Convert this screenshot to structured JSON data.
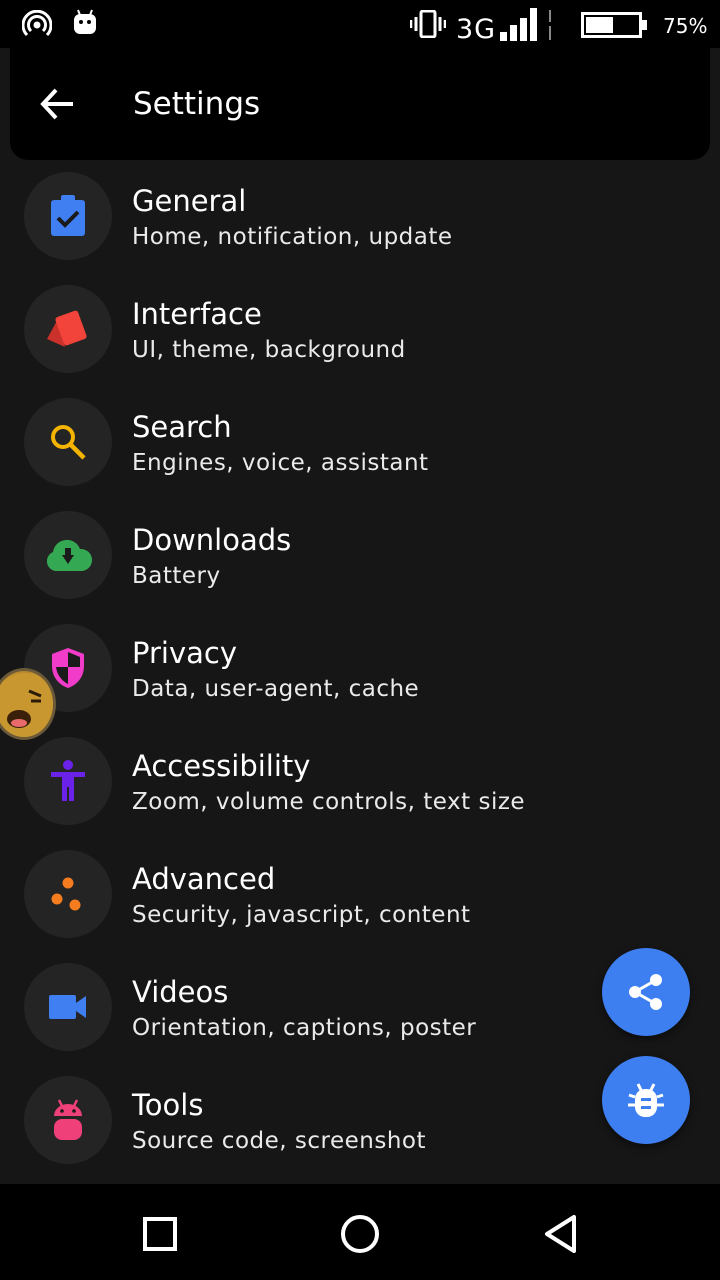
{
  "status_bar": {
    "network": "3G",
    "battery_percent": "75%",
    "battery_level": 0.75,
    "icons": [
      "hotspot-icon",
      "android-icon",
      "vibrate-icon",
      "signal-icon",
      "battery-icon"
    ]
  },
  "app_bar": {
    "title": "Settings",
    "back_icon": "arrow-back-icon"
  },
  "settings": [
    {
      "title": "General",
      "subtitle": "Home, notification, update",
      "icon": "clipboard-check-icon",
      "color": "#3f7ff2"
    },
    {
      "title": "Interface",
      "subtitle": "UI, theme, background",
      "icon": "cards-icon",
      "color": "#f2443a"
    },
    {
      "title": "Search",
      "subtitle": "Engines, voice, assistant",
      "icon": "search-icon",
      "color": "#f4b400"
    },
    {
      "title": "Downloads",
      "subtitle": "Battery",
      "icon": "cloud-download-icon",
      "color": "#34a853"
    },
    {
      "title": "Privacy",
      "subtitle": "Data, user-agent, cache",
      "icon": "shield-icon",
      "color": "#f03cc8"
    },
    {
      "title": "Accessibility",
      "subtitle": "Zoom, volume controls, text size",
      "icon": "accessibility-icon",
      "color": "#6a22e8"
    },
    {
      "title": "Advanced",
      "subtitle": "Security, javascript, content",
      "icon": "dots-icon",
      "color": "#f57c1f"
    },
    {
      "title": "Videos",
      "subtitle": "Orientation, captions, poster",
      "icon": "videocam-icon",
      "color": "#3f7ff2"
    },
    {
      "title": "Tools",
      "subtitle": "Source code, screenshot",
      "icon": "android-icon",
      "color": "#f0407a"
    }
  ],
  "fabs": {
    "share_icon": "share-icon",
    "bug_icon": "bug-icon",
    "color": "#3d7ff0"
  },
  "nav_bar": {
    "icons": [
      "recents-square-icon",
      "home-circle-icon",
      "back-triangle-icon"
    ]
  }
}
